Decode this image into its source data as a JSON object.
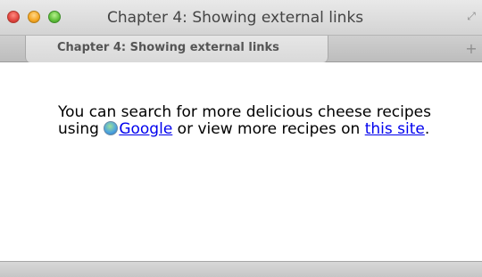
{
  "window": {
    "title": "Chapter 4: Showing external links",
    "fullscreen_icon": "fullscreen-icon"
  },
  "tabs": [
    {
      "label": "Chapter 4: Showing external links",
      "active": true
    }
  ],
  "new_tab": {
    "label": "+"
  },
  "content": {
    "text_1": "You can search for more delicious cheese recipes using ",
    "link_google": "Google",
    "text_2": " or view more recipes on ",
    "link_site": "this site",
    "text_3": "."
  },
  "icons": {
    "google_link_icon": "google-favicon-icon"
  }
}
